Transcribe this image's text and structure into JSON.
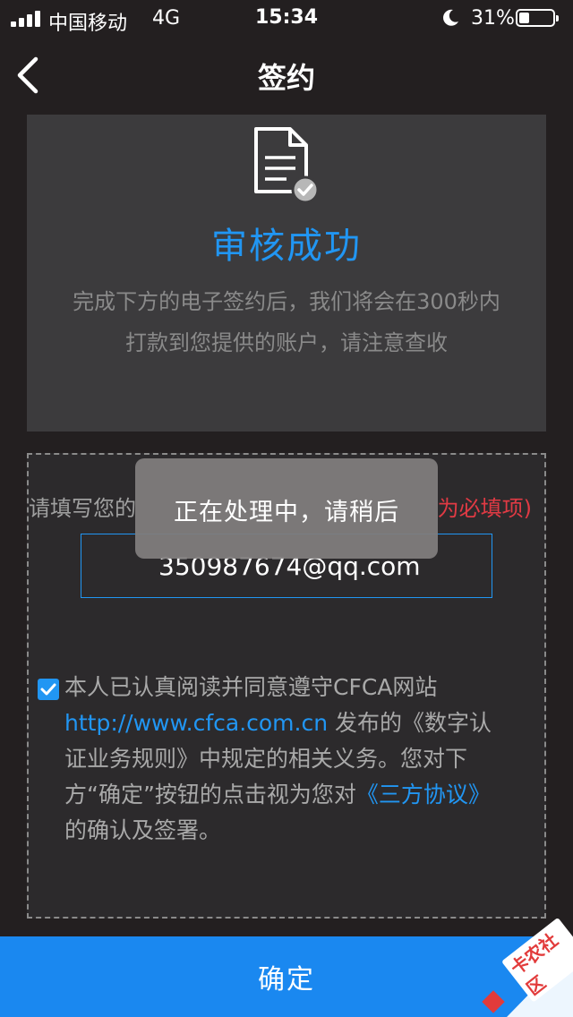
{
  "status_bar": {
    "carrier": "中国移动",
    "network": "4G",
    "time": "15:34",
    "battery_percent": "31%",
    "battery_level": 0.31,
    "icons": [
      "signal-icon",
      "moon-icon",
      "battery-icon"
    ]
  },
  "nav": {
    "title": "签约",
    "back_icon": "chevron-left-icon"
  },
  "status_card": {
    "icon": "document-check-icon",
    "title": "审核成功",
    "description_line1": "完成下方的电子签约后，我们将会在300秒内",
    "description_line2": "打款到您提供的账户，请注意查收"
  },
  "form": {
    "label_visible": "请填写您的",
    "required_visible": "为必填项)",
    "email_value": "350987674@qq.com"
  },
  "agreement": {
    "checked": true,
    "text_part1": "本人已认真阅读并同意遵守CFCA网站",
    "link_url": "http://www.cfca.com.cn",
    "text_part2": " 发布的《数字认证业务规则》中规定的相关义务。您对下方“确定”按钮的点击视为您对",
    "link_agreement": "《三方协议》",
    "text_part3": "的确认及签署。"
  },
  "toast": {
    "message": "正在处理中，请稍后"
  },
  "confirm_button": {
    "label": "确定"
  },
  "watermark": {
    "text": "卡农社区"
  },
  "colors": {
    "background": "#231f20",
    "card": "#3c3b3d",
    "accent": "#2196f3",
    "required": "#e03a44",
    "button": "#1a88f0"
  }
}
